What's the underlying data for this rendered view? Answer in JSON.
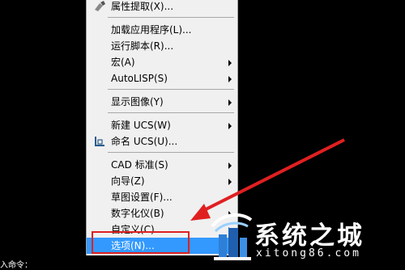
{
  "menu": {
    "items": [
      {
        "label": "属性提取(X)...",
        "submenu": false,
        "icon": "attribute-extract-icon"
      },
      {
        "label": "加载应用程序(L)...",
        "submenu": false
      },
      {
        "label": "运行脚本(R)...",
        "submenu": false
      },
      {
        "label": "宏(A)",
        "submenu": true
      },
      {
        "label": "AutoLISP(S)",
        "submenu": true
      },
      {
        "label": "显示图像(Y)",
        "submenu": true
      },
      {
        "label": "新建 UCS(W)",
        "submenu": true
      },
      {
        "label": "命名 UCS(U)...",
        "submenu": false,
        "icon": "named-ucs-icon"
      },
      {
        "label": "CAD 标准(S)",
        "submenu": true
      },
      {
        "label": "向导(Z)",
        "submenu": true
      },
      {
        "label": "草图设置(F)...",
        "submenu": false
      },
      {
        "label": "数字化仪(B)",
        "submenu": true
      },
      {
        "label": "自定义(C)",
        "submenu": true
      },
      {
        "label": "选项(N)...",
        "submenu": false,
        "selected": true
      }
    ]
  },
  "command_prompt": "入命令：",
  "watermark": {
    "title": "系统之城",
    "subtitle": "xitong86.com"
  },
  "colors": {
    "highlight": "#3399ff",
    "annotation": "#e02020"
  }
}
